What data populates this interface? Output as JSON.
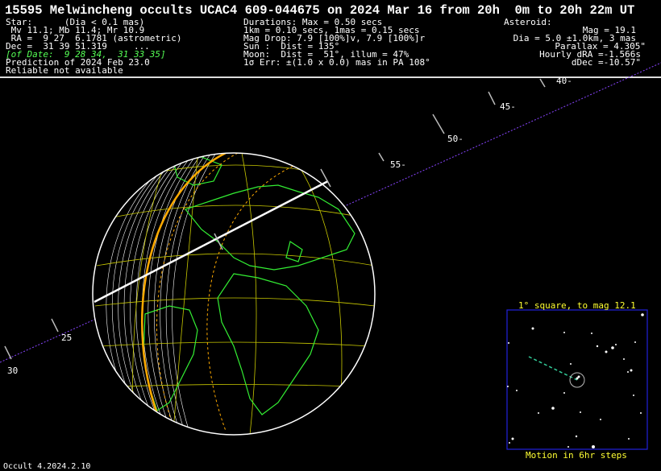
{
  "title": "15595 Melwincheng occults UCAC4 609-044675 on 2024 Mar 16 from 20h  0m to 20h 22m UT",
  "star": {
    "line1": "Star:      (Dia < 0.1 mas)",
    "line2": " Mv 11.1; Mb 11.4; Mr 10.9",
    "line3": " RA =  9 27  6.1781 (astrometric)",
    "line4": "Dec =  31 39 51.319     ...",
    "line5": "[of Date:  9 28 34,  31 33 35]",
    "line6": "Prediction of 2024 Feb 23.0",
    "line7": "Reliable not available"
  },
  "event": {
    "line1": "Durations: Max = 0.50 secs",
    "line2": "1km = 0.10 secs, 1mas = 0.15 secs",
    "line3": "Mag Drop: 7.9 [100%]v, 7.9 [100%]r",
    "line4": "Sun :  Dist = 135°",
    "line5": "Moon:  Dist =  51°, illum = 47%",
    "line6": "1σ Err: ±(1.0 x 0.0) mas in PA 108°"
  },
  "asteroid": {
    "line1": "Asteroid:",
    "line2": "Mag = 19.1",
    "line3": "Dia = 5.0 ±1.0km, 3 mas",
    "line4": "Parallax = 4.305\"",
    "line5": "Hourly dRA =-1.566s",
    "line6": "dDec =-10.57\""
  },
  "track_labels": [
    "40-",
    "45-",
    "50-",
    "55-",
    "25",
    "30"
  ],
  "inset": {
    "title": "1° square, to mag 12.1",
    "footer": "Motion in 6hr steps"
  },
  "footer": "Occult 4.2024.2.10",
  "colors": {
    "land": "#33ee33",
    "grid": "#c8c800",
    "limb": "#ffffff",
    "shadow_edge": "#ffaa00",
    "track": "#8844ff",
    "inset_border": "#2222dd",
    "inset_title": "#ffff33"
  }
}
